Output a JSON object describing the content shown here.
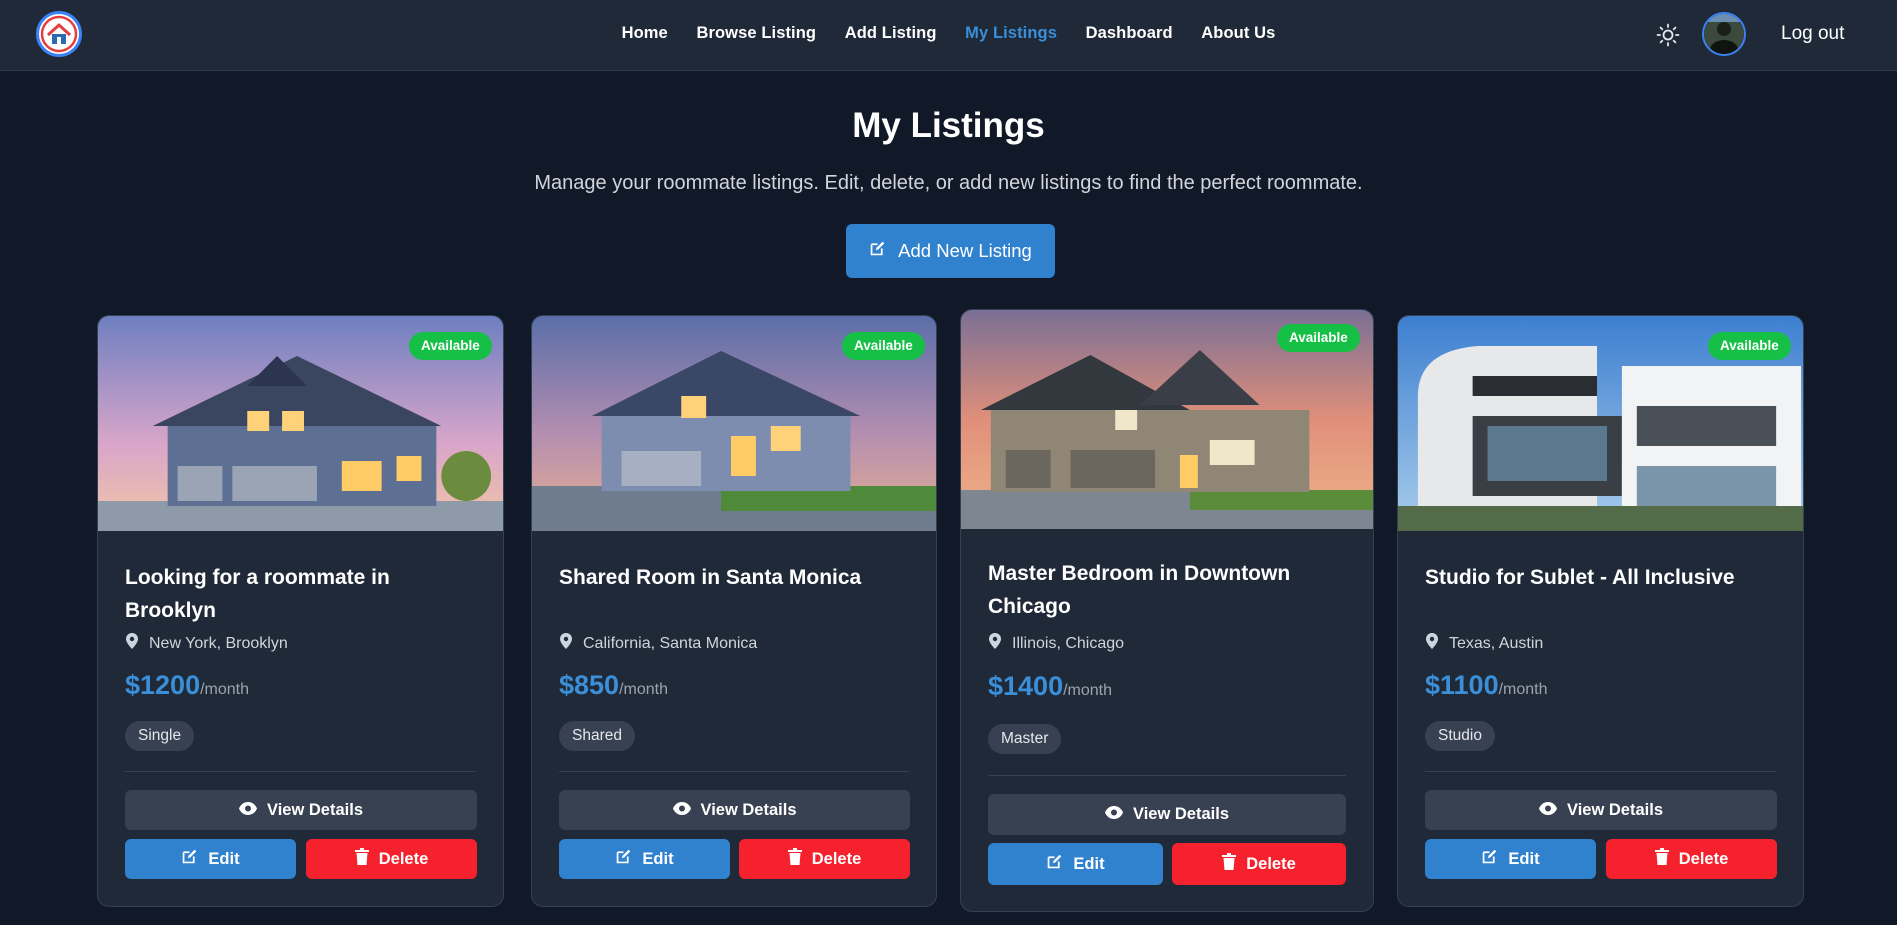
{
  "nav": {
    "links": [
      "Home",
      "Browse Listing",
      "Add Listing",
      "My Listings",
      "Dashboard",
      "About Us"
    ],
    "active": "My Listings",
    "logout": "Log out"
  },
  "hero": {
    "title": "My Listings",
    "subtitle": "Manage your roommate listings. Edit, delete, or add new listings to find the perfect roommate.",
    "add_button": "Add New Listing"
  },
  "listings": [
    {
      "status": "Available",
      "title": "Looking for a roommate in Brooklyn",
      "location": "New York, Brooklyn",
      "price": "$1200",
      "per": "/month",
      "room_type": "Single",
      "view": "View Details",
      "edit": "Edit",
      "delete": "Delete"
    },
    {
      "status": "Available",
      "title": "Shared Room in Santa Monica",
      "location": "California, Santa Monica",
      "price": "$850",
      "per": "/month",
      "room_type": "Shared",
      "view": "View Details",
      "edit": "Edit",
      "delete": "Delete"
    },
    {
      "status": "Available",
      "title": "Master Bedroom in Downtown Chicago",
      "location": "Illinois, Chicago",
      "price": "$1400",
      "per": "/month",
      "room_type": "Master",
      "view": "View Details",
      "edit": "Edit",
      "delete": "Delete"
    },
    {
      "status": "Available",
      "title": "Studio for Sublet - All Inclusive",
      "location": "Texas, Austin",
      "price": "$1100",
      "per": "/month",
      "room_type": "Studio",
      "view": "View Details",
      "edit": "Edit",
      "delete": "Delete"
    }
  ],
  "colors": {
    "page_bg": "#111827",
    "card_bg": "#1f2937",
    "accent": "#3182ce",
    "available": "#16c047",
    "delete": "#f5222d"
  },
  "icons": {
    "logo": "house-logo-icon",
    "theme": "sun-icon",
    "add": "edit-square-icon",
    "location": "map-pin-icon",
    "view": "eye-icon",
    "edit": "edit-square-icon",
    "delete": "trash-icon"
  }
}
